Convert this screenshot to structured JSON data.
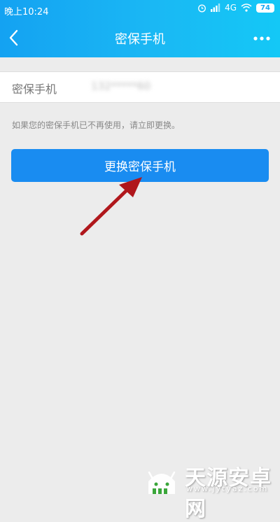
{
  "status_bar": {
    "time": "晚上10:24",
    "network": "4G",
    "battery": "74"
  },
  "nav": {
    "title": "密保手机"
  },
  "phone": {
    "label": "密保手机",
    "value": "132*****60"
  },
  "hint": "如果您的密保手机已不再使用，请立即更换。",
  "button": {
    "label": "更换密保手机"
  },
  "watermark": {
    "title": "天源安卓网",
    "url": "www.jytyaz.com"
  },
  "colors": {
    "header": "#14a2f2",
    "button": "#198cf1",
    "background": "#ececec",
    "arrow": "#b0171c"
  }
}
